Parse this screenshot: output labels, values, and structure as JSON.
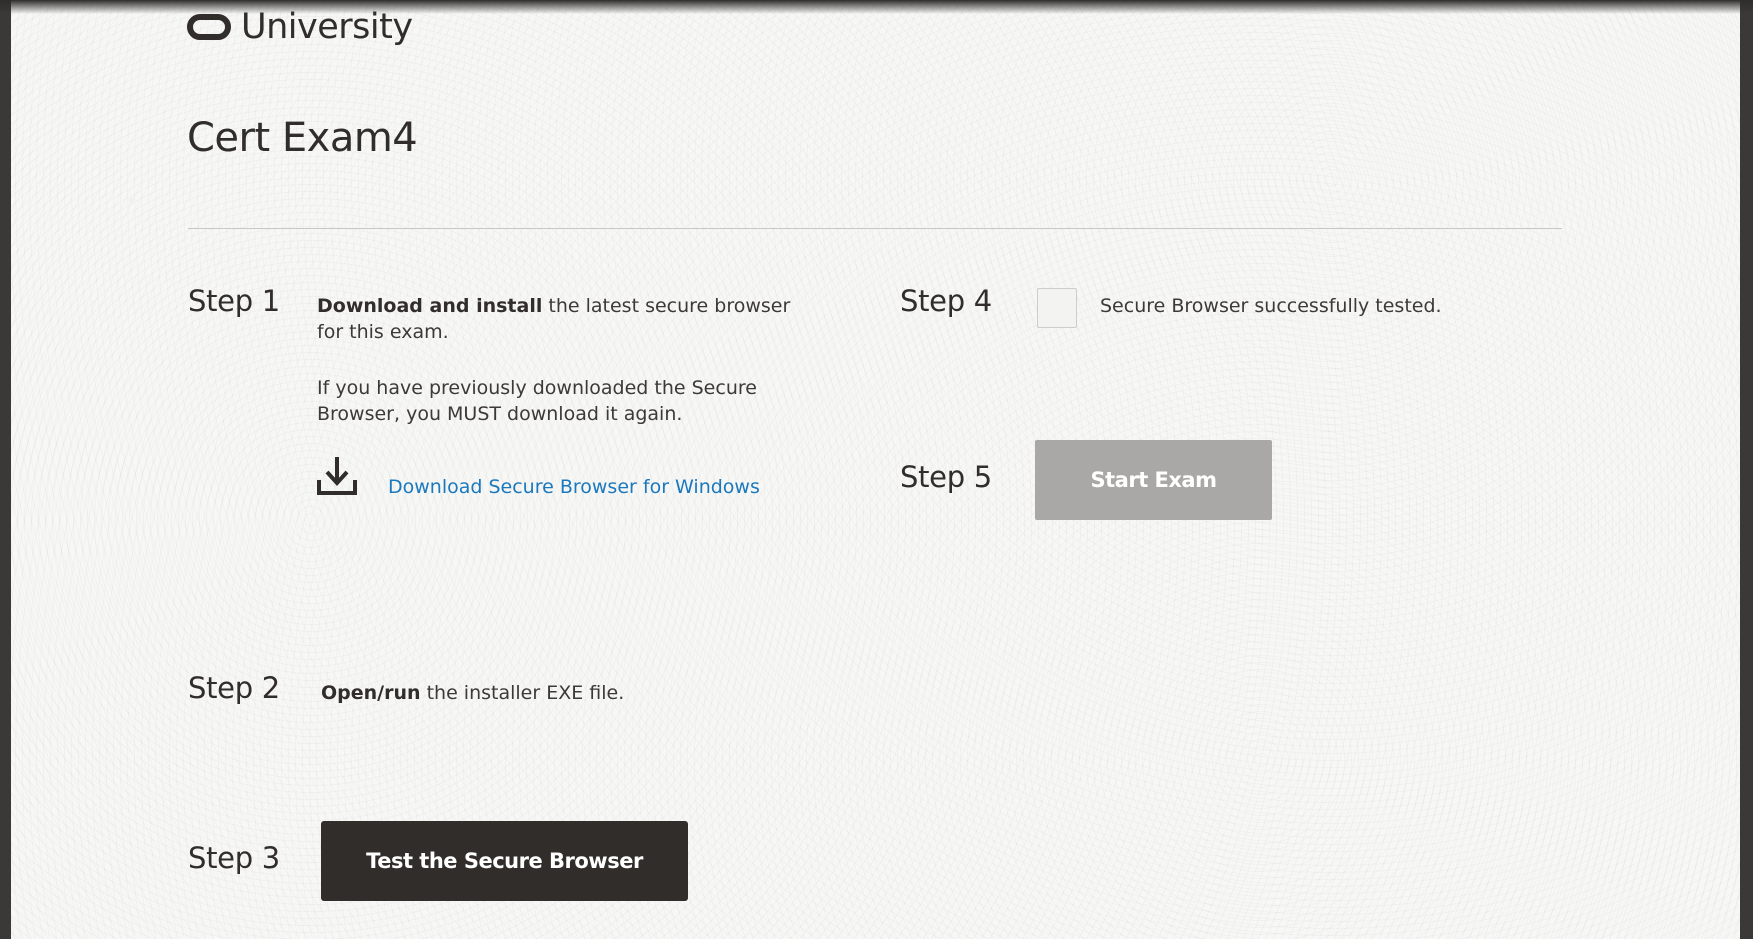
{
  "brand": {
    "logo_text": "University"
  },
  "exam": {
    "title": "Cert Exam4"
  },
  "steps": {
    "step1": {
      "label": "Step 1",
      "bold": "Download and install",
      "text": " the latest secure browser for this exam.",
      "note": "If you have previously downloaded the Secure Browser, you MUST download it again.",
      "link": "Download Secure Browser for Windows"
    },
    "step2": {
      "label": "Step 2",
      "bold": "Open/run",
      "text": " the installer EXE file."
    },
    "step3": {
      "label": "Step 3",
      "button": "Test the Secure Browser"
    },
    "step4": {
      "label": "Step 4",
      "checkbox_label": "Secure Browser successfully tested.",
      "checked": false
    },
    "step5": {
      "label": "Step 5",
      "button": "Start Exam",
      "enabled": false
    }
  },
  "colors": {
    "link": "#1a78bd",
    "primary_button": "#312d2a",
    "disabled_button": "#a9a8a6",
    "page_background": "#f7f7f6"
  },
  "icons": {
    "download": "download-icon",
    "logo": "oracle-logo-icon"
  }
}
